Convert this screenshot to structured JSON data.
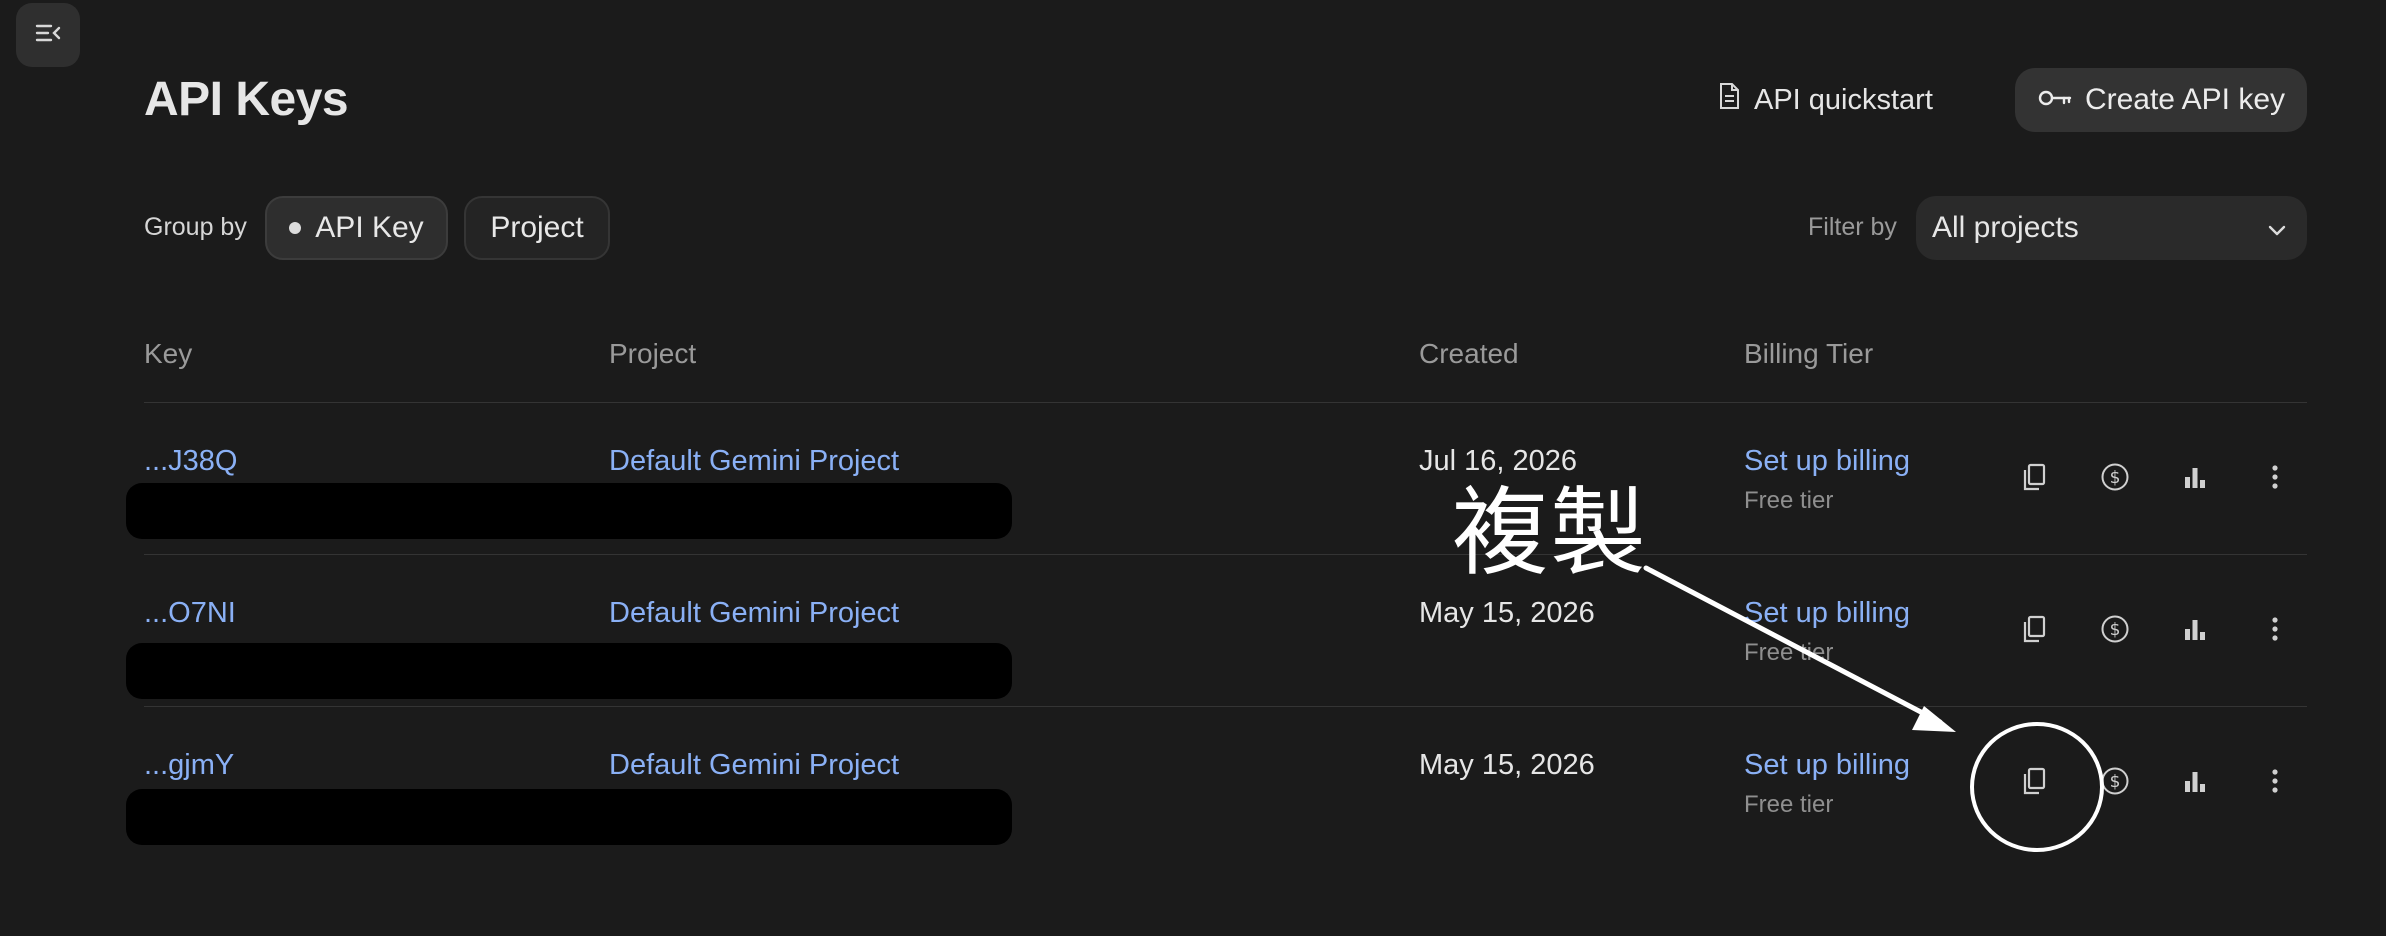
{
  "page": {
    "title": "API Keys"
  },
  "header": {
    "quickstart_label": "API quickstart",
    "create_label": "Create API key"
  },
  "controls": {
    "group_by_label": "Group by",
    "group_options": [
      "API Key",
      "Project"
    ],
    "group_selected": "API Key",
    "filter_label": "Filter by",
    "filter_value": "All projects"
  },
  "table": {
    "columns": [
      "Key",
      "Project",
      "Created",
      "Billing Tier"
    ],
    "rows": [
      {
        "key": "...J38Q",
        "project": "Default Gemini Project",
        "created": "Jul 16, 2026",
        "billing": "Set up billing",
        "tier": "Free tier"
      },
      {
        "key": "...O7NI",
        "project": "Default Gemini Project",
        "created": "May 15, 2026",
        "billing": "Set up billing",
        "tier": "Free tier"
      },
      {
        "key": "...gjmY",
        "project": "Default Gemini Project",
        "created": "May 15, 2026",
        "billing": "Set up billing",
        "tier": "Free tier"
      }
    ]
  },
  "annotation": {
    "text": "複製",
    "color": "#ffffff"
  },
  "icons": [
    "sidebar-toggle-icon",
    "document-icon",
    "key-icon",
    "chevron-down-icon",
    "copy-icon",
    "dollar-icon",
    "bar-chart-icon",
    "more-vert-icon"
  ],
  "colors": {
    "background": "#1b1b1b",
    "link": "#8ab0f5",
    "muted": "#9a9a9a"
  }
}
